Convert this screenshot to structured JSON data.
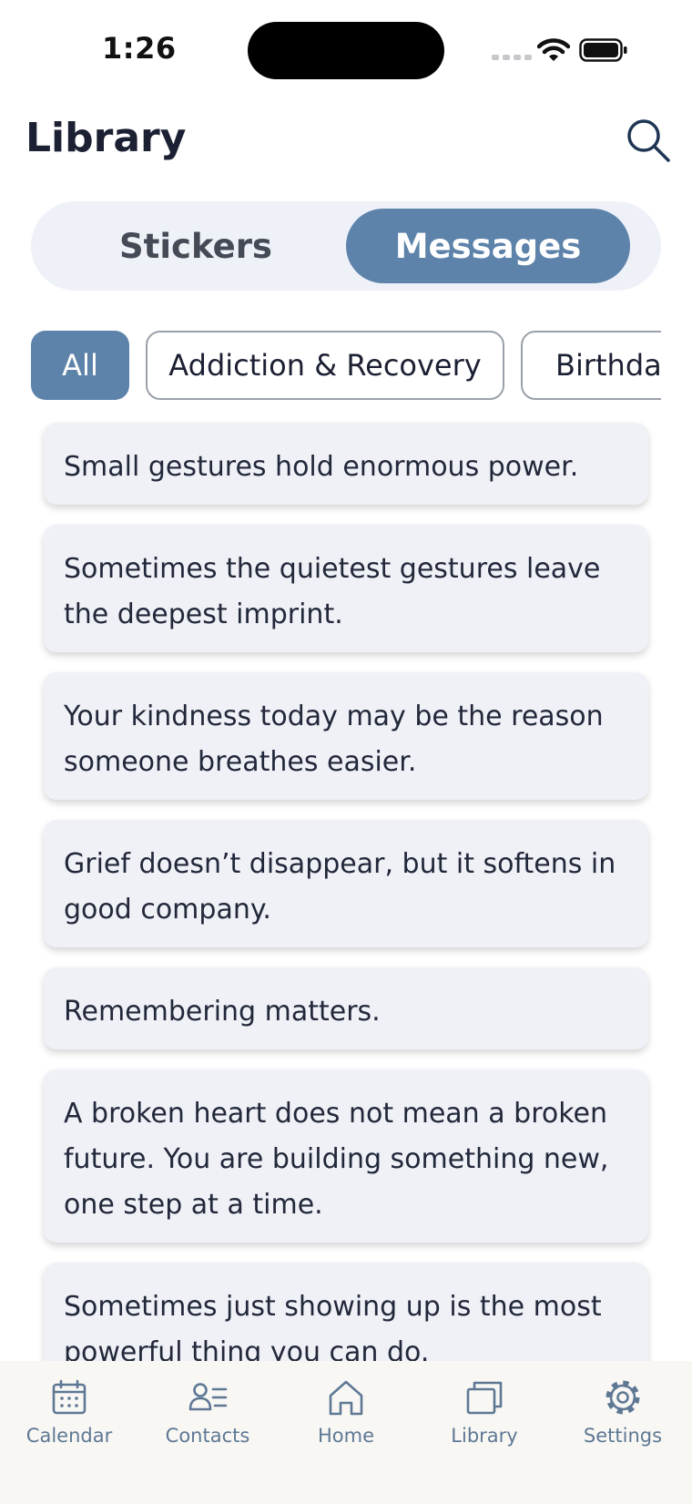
{
  "status_bar": {
    "time": "1:26"
  },
  "header": {
    "title": "Library",
    "search_icon": "search-icon"
  },
  "segments": [
    {
      "label": "Stickers",
      "selected": false
    },
    {
      "label": "Messages",
      "selected": true
    }
  ],
  "filters": [
    {
      "label": "All",
      "selected": true
    },
    {
      "label": "Addiction & Recovery",
      "selected": false
    },
    {
      "label": "Birthday",
      "selected": false
    }
  ],
  "messages": [
    "Small gestures hold enormous power.",
    "Sometimes the quietest gestures leave the deepest imprint.",
    "Your kindness today may be the reason someone breathes easier.",
    "Grief doesn’t disappear, but it softens in good company.",
    "Remembering matters.",
    "A broken heart does not mean a broken future. You are building something new, one step at a time.",
    "Sometimes just showing up is the most powerful thing you can do."
  ],
  "tabbar": [
    {
      "label": "Calendar",
      "icon": "calendar-icon"
    },
    {
      "label": "Contacts",
      "icon": "contacts-icon"
    },
    {
      "label": "Home",
      "icon": "home-icon"
    },
    {
      "label": "Library",
      "icon": "library-icon",
      "selected": true
    },
    {
      "label": "Settings",
      "icon": "gear-icon"
    }
  ],
  "colors": {
    "accent": "#5e83ab",
    "card_bg": "#eff1f7",
    "segment_bg": "#eef1f7",
    "tab_icon": "#5e7894",
    "title": "#1c2033"
  }
}
